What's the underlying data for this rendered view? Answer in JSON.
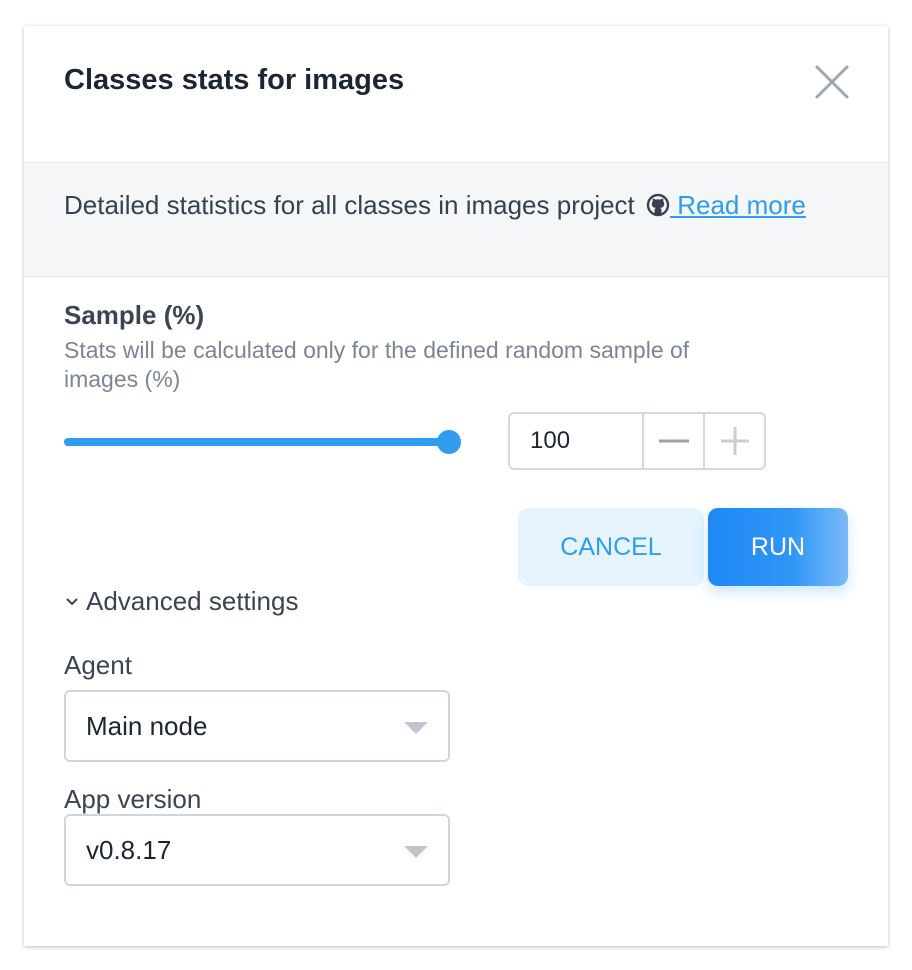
{
  "dialog": {
    "title": "Classes stats for images",
    "close_icon": "close-icon"
  },
  "description": {
    "text": "Detailed statistics for all classes in images project",
    "icon": "github-icon",
    "link_label": " Read more"
  },
  "sample": {
    "label": "Sample (%)",
    "description": "Stats will be calculated only for the defined random sample of images (%)",
    "value": 100,
    "value_text": "100",
    "slider_fraction": 1.0,
    "minus_label": "−",
    "plus_label": "+"
  },
  "actions": {
    "cancel_label": "CANCEL",
    "run_label": "RUN"
  },
  "advanced": {
    "label": "Advanced settings",
    "expanded": true
  },
  "agent": {
    "label": "Agent",
    "selected": "Main node"
  },
  "app_version": {
    "label": "App version",
    "selected": "v0.8.17"
  },
  "colors": {
    "accent": "#2f9cf0",
    "title": "#1c2533",
    "muted": "#7b8594"
  }
}
